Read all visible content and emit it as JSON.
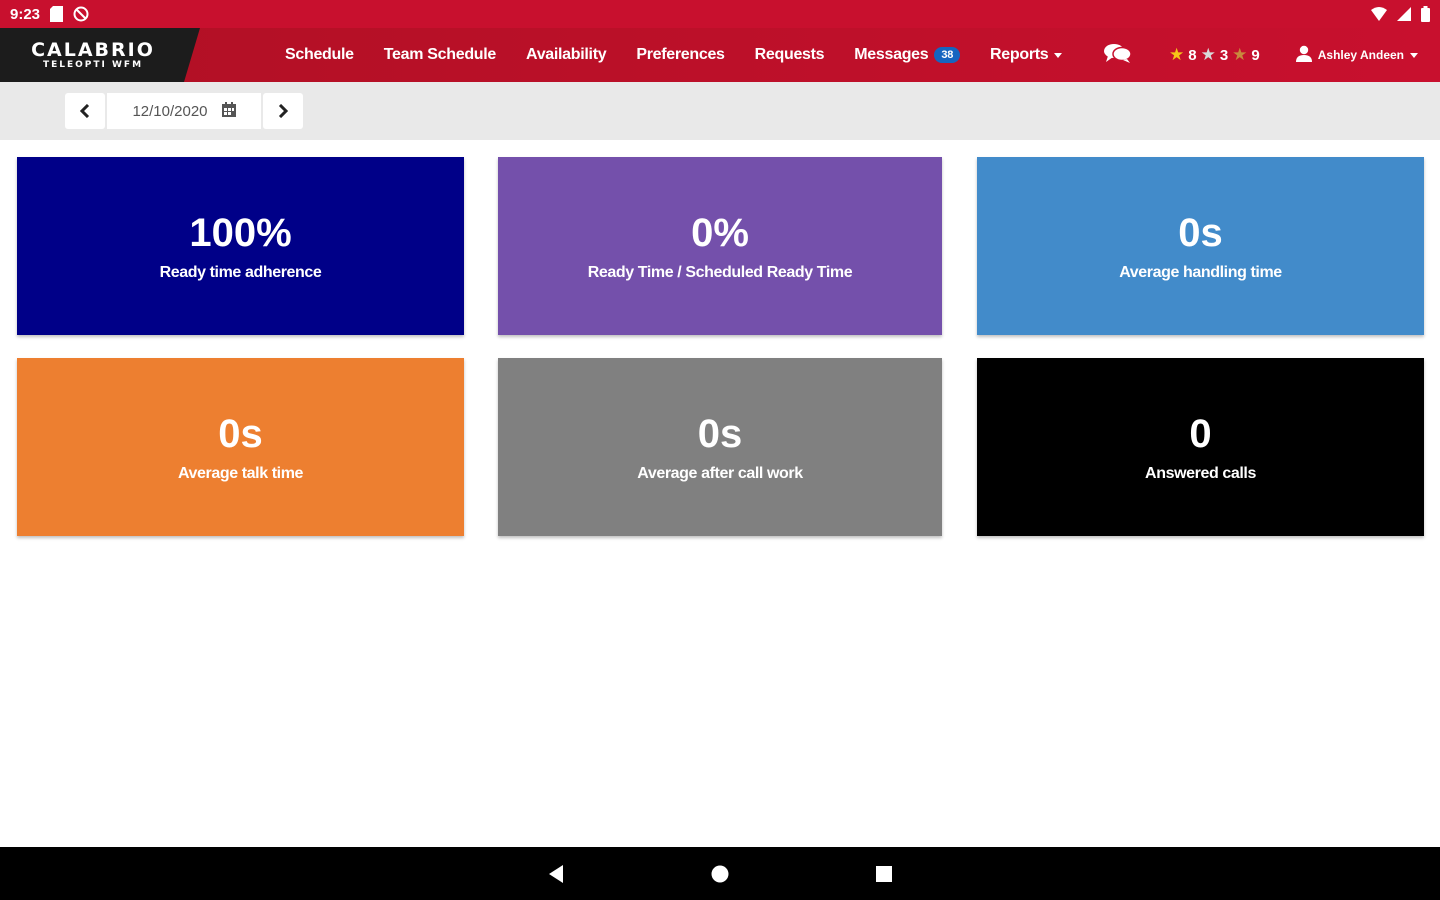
{
  "status_bar": {
    "time": "9:23"
  },
  "brand": {
    "name": "CALABRIO",
    "subtitle": "TELEOPTI WFM"
  },
  "nav": {
    "items": [
      {
        "label": "Schedule"
      },
      {
        "label": "Team Schedule"
      },
      {
        "label": "Availability"
      },
      {
        "label": "Preferences"
      },
      {
        "label": "Requests"
      },
      {
        "label": "Messages",
        "badge": "38"
      },
      {
        "label": "Reports",
        "dropdown": true
      }
    ],
    "badges": {
      "gold": "8",
      "silver": "3",
      "bronze": "9"
    },
    "user_name": "Ashley Andeen"
  },
  "toolbar": {
    "date": "12/10/2020"
  },
  "tiles": [
    {
      "value": "100%",
      "label": "Ready time adherence",
      "color": "#000088"
    },
    {
      "value": "0%",
      "label": "Ready Time / Scheduled Ready Time",
      "color": "#7450ab"
    },
    {
      "value": "0s",
      "label": "Average handling time",
      "color": "#428bca"
    },
    {
      "value": "0s",
      "label": "Average talk time",
      "color": "#ed7f30"
    },
    {
      "value": "0s",
      "label": "Average after call work",
      "color": "#808080"
    },
    {
      "value": "0",
      "label": "Answered calls",
      "color": "#000000"
    }
  ],
  "colors": {
    "primary_red": "#c8102e",
    "brand_dark": "#1c1c1c",
    "badge_blue": "#1565c0"
  },
  "icons": {
    "chat": "chat-bubbles-icon",
    "user": "user-icon",
    "calendar": "calendar-icon"
  }
}
